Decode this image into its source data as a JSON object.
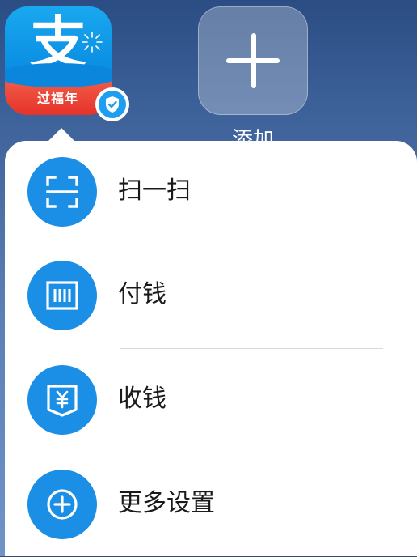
{
  "home_screen": {
    "app_icon": {
      "glyph": "支",
      "label": "过福年",
      "brand_color": "#0b8fe3",
      "band_color": "#e6332a",
      "badge_icon": "verified-shield-icon"
    },
    "add_tile": {
      "icon": "plus-icon",
      "label": "添加"
    }
  },
  "popup_menu": {
    "items": [
      {
        "label": "扫一扫",
        "icon": "scan-icon"
      },
      {
        "label": "付钱",
        "icon": "barcode-pay-icon"
      },
      {
        "label": "收钱",
        "icon": "receive-money-icon"
      },
      {
        "label": "更多设置",
        "icon": "plus-circle-icon"
      }
    ],
    "icon_color": "#1b8fe6"
  }
}
